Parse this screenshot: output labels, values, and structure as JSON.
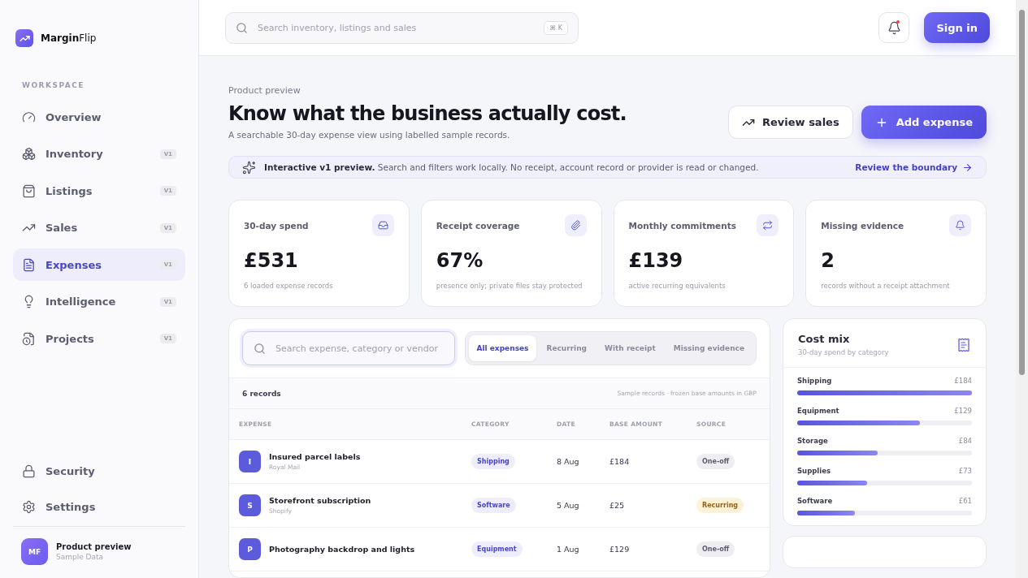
{
  "brand": {
    "bold": "Margin",
    "rest": "Flip"
  },
  "sidebar": {
    "section": "WORKSPACE",
    "items": [
      {
        "label": "Overview",
        "selected": false
      },
      {
        "label": "Inventory",
        "badge": "V1",
        "selected": false
      },
      {
        "label": "Listings",
        "badge": "V1",
        "selected": false
      },
      {
        "label": "Sales",
        "badge": "V1",
        "selected": false
      },
      {
        "label": "Expenses",
        "badge": "V1",
        "selected": true
      },
      {
        "label": "Intelligence",
        "badge": "V1",
        "selected": false
      },
      {
        "label": "Projects",
        "badge": "V1",
        "selected": false
      }
    ],
    "bottom": [
      {
        "label": "Security"
      },
      {
        "label": "Settings"
      }
    ],
    "user": {
      "initials": "MF",
      "name": "Product preview",
      "subtitle": "Sample Data"
    }
  },
  "topbar": {
    "search_placeholder": "Search inventory, listings and sales",
    "shortcut": "⌘ K",
    "sign_in": "Sign in"
  },
  "header": {
    "eyebrow": "Product preview",
    "title": "Know what the business actually cost.",
    "subtitle": "A searchable 30-day expense view using labelled sample records.",
    "secondary_button": "Review sales",
    "primary_button": "Add expense"
  },
  "notice": {
    "text": "**Interactive v1 preview.** Search and filters work locally. No receipt, account record or provider is read or changed.",
    "link": "Review the boundary"
  },
  "stats": [
    {
      "label": "30-day spend",
      "value": "£531",
      "note": "6 loaded expense records"
    },
    {
      "label": "Receipt coverage",
      "value": "67%",
      "note": "presence only; private files stay protected"
    },
    {
      "label": "Monthly commitments",
      "value": "£139",
      "note": "active recurring equivalents"
    },
    {
      "label": "Missing evidence",
      "value": "2",
      "note": "records without a receipt attachment"
    }
  ],
  "expenses": {
    "search_placeholder": "Search expense, category or vendor",
    "filters": [
      {
        "label": "All expenses",
        "selected": true
      },
      {
        "label": "Recurring",
        "selected": false
      },
      {
        "label": "With receipt",
        "selected": false
      },
      {
        "label": "Missing evidence",
        "selected": false
      }
    ],
    "count": "6 records",
    "note": "Sample records · frozen base amounts in GBP",
    "columns": [
      "EXPENSE",
      "CATEGORY",
      "DATE",
      "BASE AMOUNT",
      "SOURCE"
    ],
    "rows": [
      {
        "initial": "I",
        "name": "Insured parcel labels",
        "vendor": "Royal Mail",
        "category": "Shipping",
        "date": "8 Aug",
        "amount": "£184",
        "source": "One-off",
        "kind": "oneoff"
      },
      {
        "initial": "S",
        "name": "Storefront subscription",
        "vendor": "Shopify",
        "category": "Software",
        "date": "5 Aug",
        "amount": "£25",
        "source": "Recurring",
        "kind": "recurring"
      },
      {
        "initial": "P",
        "name": "Photography backdrop and lights",
        "category": "Equipment",
        "date": "1 Aug",
        "amount": "£129",
        "source": "One-off",
        "kind": "oneoff"
      }
    ]
  },
  "cost_mix": {
    "title": "Cost mix",
    "subtitle": "30-day spend by category",
    "items": [
      {
        "label": "Shipping",
        "amount": "£184",
        "level": 1
      },
      {
        "label": "Equipment",
        "amount": "£129",
        "level": 0.7
      },
      {
        "label": "Storage",
        "amount": "£84",
        "level": 0.46
      },
      {
        "label": "Supplies",
        "amount": "£73",
        "level": 0.4
      },
      {
        "label": "Software",
        "amount": "£61",
        "level": 0.33
      }
    ]
  }
}
